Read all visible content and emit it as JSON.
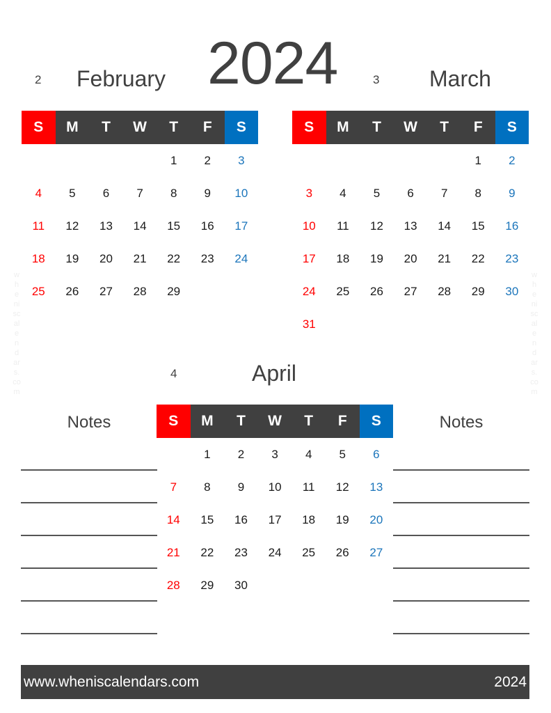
{
  "year": "2024",
  "weekdays": [
    "S",
    "M",
    "T",
    "W",
    "T",
    "F",
    "S"
  ],
  "months": [
    {
      "number": "2",
      "name": "February",
      "leading_blanks": 4,
      "days": 29
    },
    {
      "number": "3",
      "name": "March",
      "leading_blanks": 5,
      "days": 31
    },
    {
      "number": "4",
      "name": "April",
      "leading_blanks": 1,
      "days": 30
    }
  ],
  "notes": {
    "left_title": "Notes",
    "right_title": "Notes",
    "line_count": 6
  },
  "watermark": "wheniscalendars.com",
  "footer": {
    "url": "www.wheniscalendars.com",
    "year": "2024"
  },
  "colors": {
    "sunday": "#ff0000",
    "saturday": "#0070c0",
    "header": "#404040"
  }
}
